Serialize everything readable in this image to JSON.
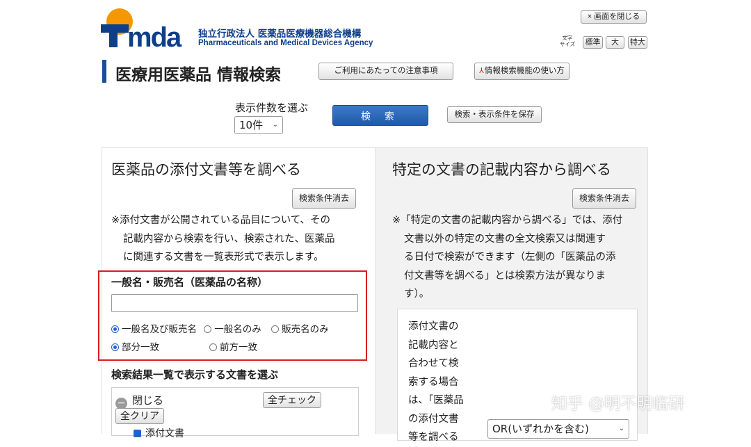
{
  "header": {
    "logo_text": "Pmda",
    "org_name_jp": "独立行政法人 医薬品医療機器総合機構",
    "org_name_en": "Pharmaceuticals and Medical Devices Agency",
    "close_screen": "× 画面を閉じる",
    "font_size_label_line1": "文字",
    "font_size_label_line2": "サイズ",
    "font_sizes": [
      "標準",
      "大",
      "特大"
    ]
  },
  "title": {
    "page_title": "医療用医薬品 情報検索",
    "notice_button": "ご利用にあたっての注意事項",
    "howto_button": "情報検索機能の使い方"
  },
  "controls": {
    "count_label": "表示件数を選ぶ",
    "count_value": "10件",
    "search_button": "検 索",
    "save_button": "検索・表示条件を保存"
  },
  "left_panel": {
    "title": "医薬品の添付文書等を調べる",
    "clear_button": "検索条件消去",
    "desc_lines": [
      "※添付文書が公開されている品目について、その",
      "記載内容から検索を行い、検索された、医薬品",
      "に関連する文書を一覧表形式で表示します。"
    ],
    "name_label": "一般名・販売名（医薬品の名称）",
    "name_input_value": "",
    "radio_target": [
      "一般名及び販売名",
      "一般名のみ",
      "販売名のみ"
    ],
    "radio_match": [
      "部分一致",
      "前方一致"
    ],
    "doc_section_title": "検索結果一覧で表示する文書を選ぶ",
    "close_label": "閉じる",
    "check_all": "全チェック",
    "clear_all": "全クリア",
    "first_doc": "添付文書"
  },
  "right_panel": {
    "title": "特定の文書の記載内容から調べる",
    "clear_button": "検索条件消去",
    "desc_lines": [
      "※「特定の文書の記載内容から調べる」では、添付",
      "文書以外の特定の文書の全文検索又は関連す",
      "る日付で検索ができます（左側の「医薬品の添",
      "付文書等を調べる」とは検索方法が異なりま",
      "す）。"
    ],
    "combine_lines": [
      "添付文書の",
      "記載内容と",
      "合わせて検",
      "索する場合",
      "は、「医薬品",
      "の添付文書",
      "等を調べる"
    ],
    "or_select_value": "OR(いずれかを含む)"
  },
  "watermark": "知乎 @明不明临研",
  "colors": {
    "brand_blue": "#1a4d96",
    "logo_orange": "#f39800",
    "search_blue": "#1e5aa8",
    "highlight_red": "#d81c24"
  }
}
